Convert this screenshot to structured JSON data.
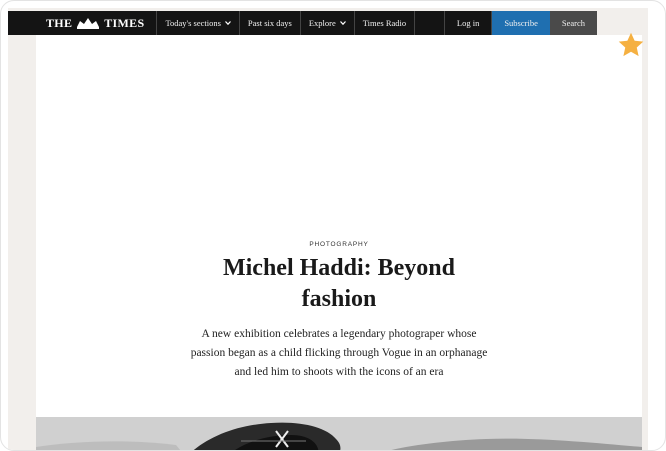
{
  "nav": {
    "logo": "THE TIMES",
    "items": [
      {
        "label": "Today's sections",
        "dropdown": true
      },
      {
        "label": "Past six days",
        "dropdown": false
      },
      {
        "label": "Explore",
        "dropdown": true
      },
      {
        "label": "Times Radio",
        "dropdown": false
      }
    ],
    "login": "Log in",
    "subscribe": "Subscribe",
    "search": "Search"
  },
  "article": {
    "kicker": "PHOTOGRAPHY",
    "headline": "Michel Haddi: Beyond fashion",
    "standfirst": "A new exhibition celebrates a legendary photograper whose passion began as a child flicking through Vogue in an orphanage and led him to shoots with the icons of an era"
  },
  "colors": {
    "nav_bg": "#141414",
    "subscribe_bg": "#1f6fb0",
    "search_bg": "#4a4a4a",
    "star": "#f5b041"
  },
  "icons": {
    "favorite": "star-icon",
    "dropdown": "chevron-down-icon",
    "logo": "crest-icon"
  }
}
